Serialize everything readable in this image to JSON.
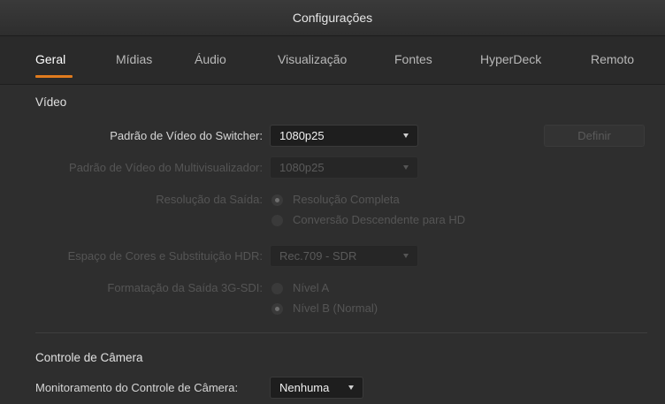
{
  "window": {
    "title": "Configurações"
  },
  "tabs": [
    {
      "label": "Geral",
      "active": true
    },
    {
      "label": "Mídias"
    },
    {
      "label": "Áudio"
    },
    {
      "label": "Visualização"
    },
    {
      "label": "Fontes"
    },
    {
      "label": "HyperDeck"
    },
    {
      "label": "Remoto"
    }
  ],
  "video": {
    "section_title": "Vídeo",
    "switcher_standard": {
      "label": "Padrão de Vídeo do Switcher:",
      "value": "1080p25"
    },
    "define_button": "Definir",
    "multiview_standard": {
      "label": "Padrão de Vídeo do Multivisualizador:",
      "value": "1080p25"
    },
    "output_resolution": {
      "label": "Resolução da Saída:",
      "options": [
        "Resolução Completa",
        "Conversão Descendente para HD"
      ],
      "selected": "Resolução Completa"
    },
    "color_space": {
      "label": "Espaço de Cores e Substituição HDR:",
      "value": "Rec.709 - SDR"
    },
    "sdi_format": {
      "label": "Formatação da Saída 3G-SDI:",
      "options": [
        "Nível A",
        "Nível B (Normal)"
      ],
      "selected": "Nível B (Normal)"
    }
  },
  "camera_control": {
    "section_title": "Controle de Câmera",
    "monitoring": {
      "label": "Monitoramento do Controle de Câmera:",
      "value": "Nenhuma"
    }
  },
  "colors": {
    "accent": "#e07b1e",
    "background": "#2e2e2e",
    "disabled_text": "#555555"
  }
}
